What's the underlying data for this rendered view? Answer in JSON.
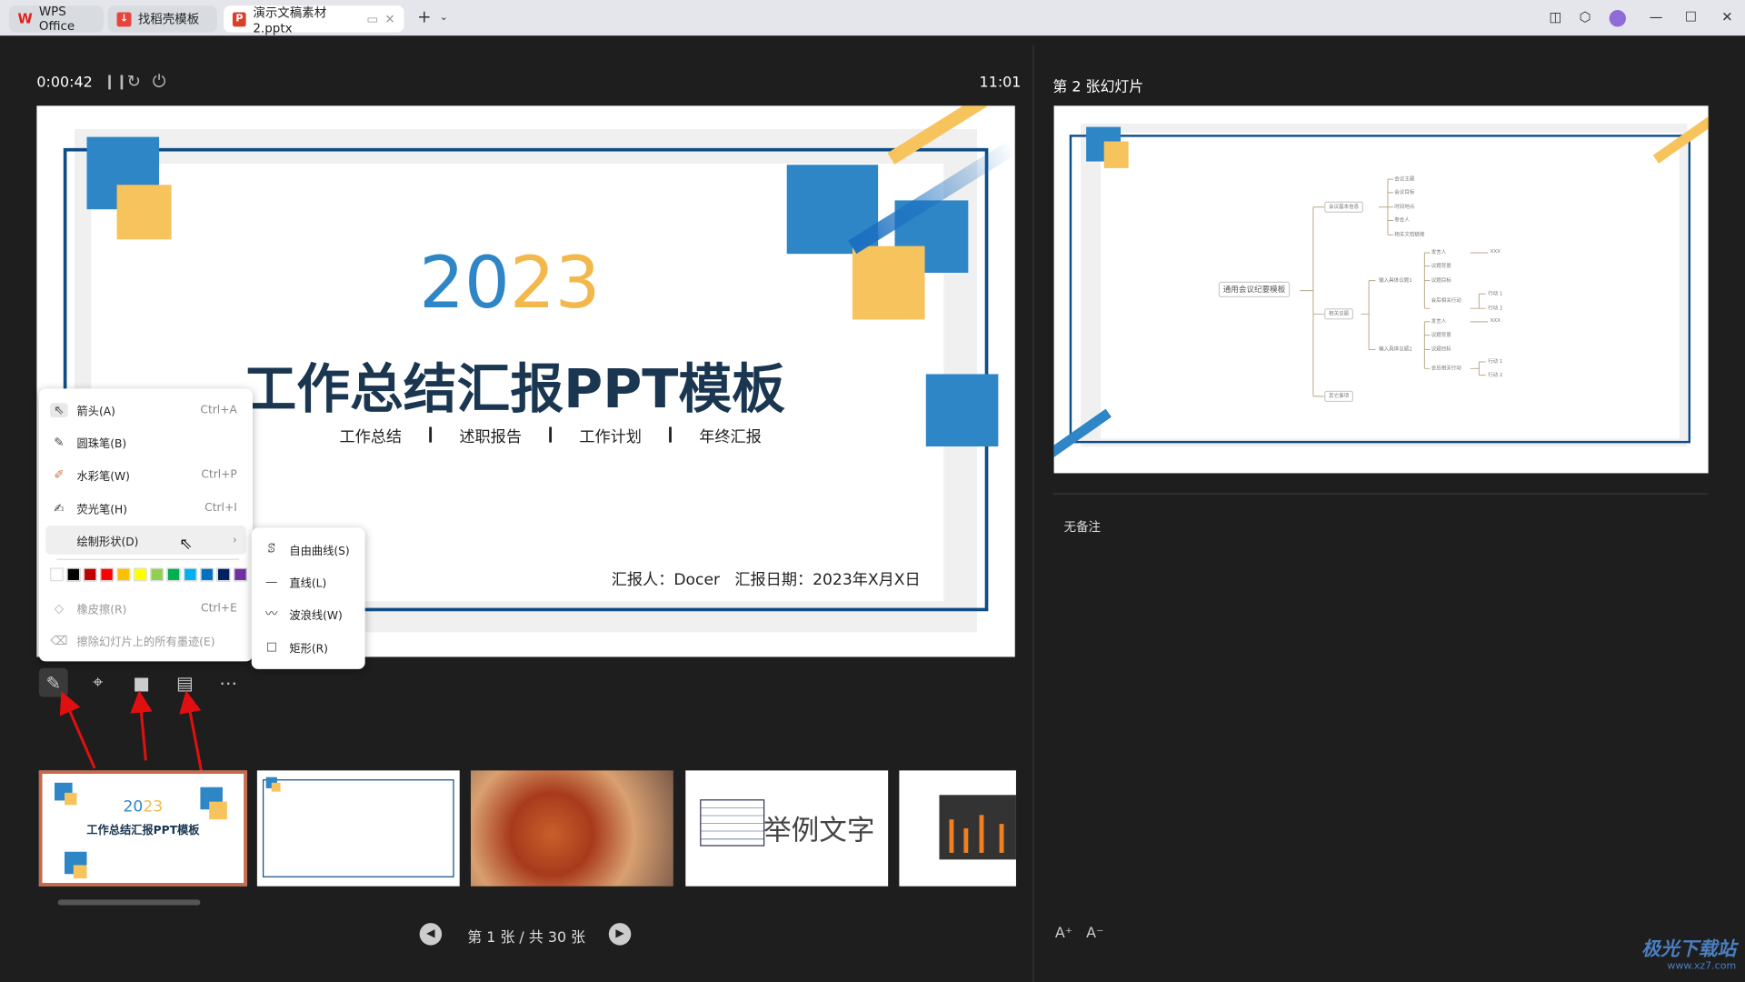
{
  "tabs": [
    {
      "label": "WPS Office",
      "icon": "wps-logo-icon"
    },
    {
      "label": "找稻壳模板",
      "icon": "docer-icon"
    },
    {
      "label": "演示文稿素材2.pptx",
      "icon": "ppt-icon",
      "active": true
    }
  ],
  "timer": {
    "elapsed": "0:00:42",
    "clock": "11:01"
  },
  "slide": {
    "year_a": "20",
    "year_b": "23",
    "title": "工作总结汇报PPT模板",
    "subtitles": [
      "工作总结",
      "述职报告",
      "工作计划",
      "年终汇报"
    ],
    "reporter": "汇报人：Docer   汇报日期：2023年X月X日",
    "colors": {
      "blue": "#2f86c7",
      "yellow": "#f7c35c",
      "frame": "#0e4d87",
      "title": "#1a3650"
    }
  },
  "menu": {
    "items": [
      {
        "label": "箭头(A)",
        "shortcut": "Ctrl+A",
        "icon": "arrow-pointer-icon"
      },
      {
        "label": "圆珠笔(B)",
        "shortcut": "",
        "icon": "ballpoint-pen-icon"
      },
      {
        "label": "水彩笔(W)",
        "shortcut": "Ctrl+P",
        "icon": "watercolor-pen-icon"
      },
      {
        "label": "荧光笔(H)",
        "shortcut": "Ctrl+I",
        "icon": "highlighter-icon"
      },
      {
        "label": "绘制形状(D)",
        "shortcut": "",
        "icon": "chevron-right-icon"
      }
    ],
    "colors": [
      "#ffffff",
      "#000000",
      "#c00000",
      "#ff0000",
      "#ffc000",
      "#ffff00",
      "#92d050",
      "#00b050",
      "#00b0f0",
      "#0070c0",
      "#002060",
      "#7030a0"
    ],
    "eraser": {
      "label": "橡皮擦(R)",
      "shortcut": "Ctrl+E"
    },
    "clear": {
      "label": "擦除幻灯片上的所有墨迹(E)"
    }
  },
  "submenu": [
    {
      "label": "自由曲线(S)",
      "icon": "freeform-icon"
    },
    {
      "label": "直线(L)",
      "icon": "line-icon"
    },
    {
      "label": "波浪线(W)",
      "icon": "wave-line-icon"
    },
    {
      "label": "矩形(R)",
      "icon": "rectangle-icon"
    }
  ],
  "nav": {
    "page_text": "第 1 张 / 共 30 张"
  },
  "right": {
    "next_label": "第 2 张幻灯片",
    "notes": "无备注",
    "font_up": "A⁺",
    "font_down": "A⁻"
  },
  "mindmap": {
    "root": "通用会议纪要模板",
    "b1": "会议基本信息",
    "b1c": [
      "会议主题",
      "会议目标",
      "时间地点",
      "参会人",
      "相关文档链接"
    ],
    "b2": "相关议题",
    "t1": "输入具体议题1",
    "t2": "输入具体议题2",
    "tc": [
      "发言人",
      "议题背景",
      "议题目标",
      "会后相关行动"
    ],
    "xxx": "XXX",
    "acts": [
      "行动 1",
      "行动 2"
    ],
    "b3": "其它事项"
  },
  "thumb4_text": "举例文字",
  "watermark": {
    "name": "极光下载站",
    "url": "www.xz7.com"
  }
}
